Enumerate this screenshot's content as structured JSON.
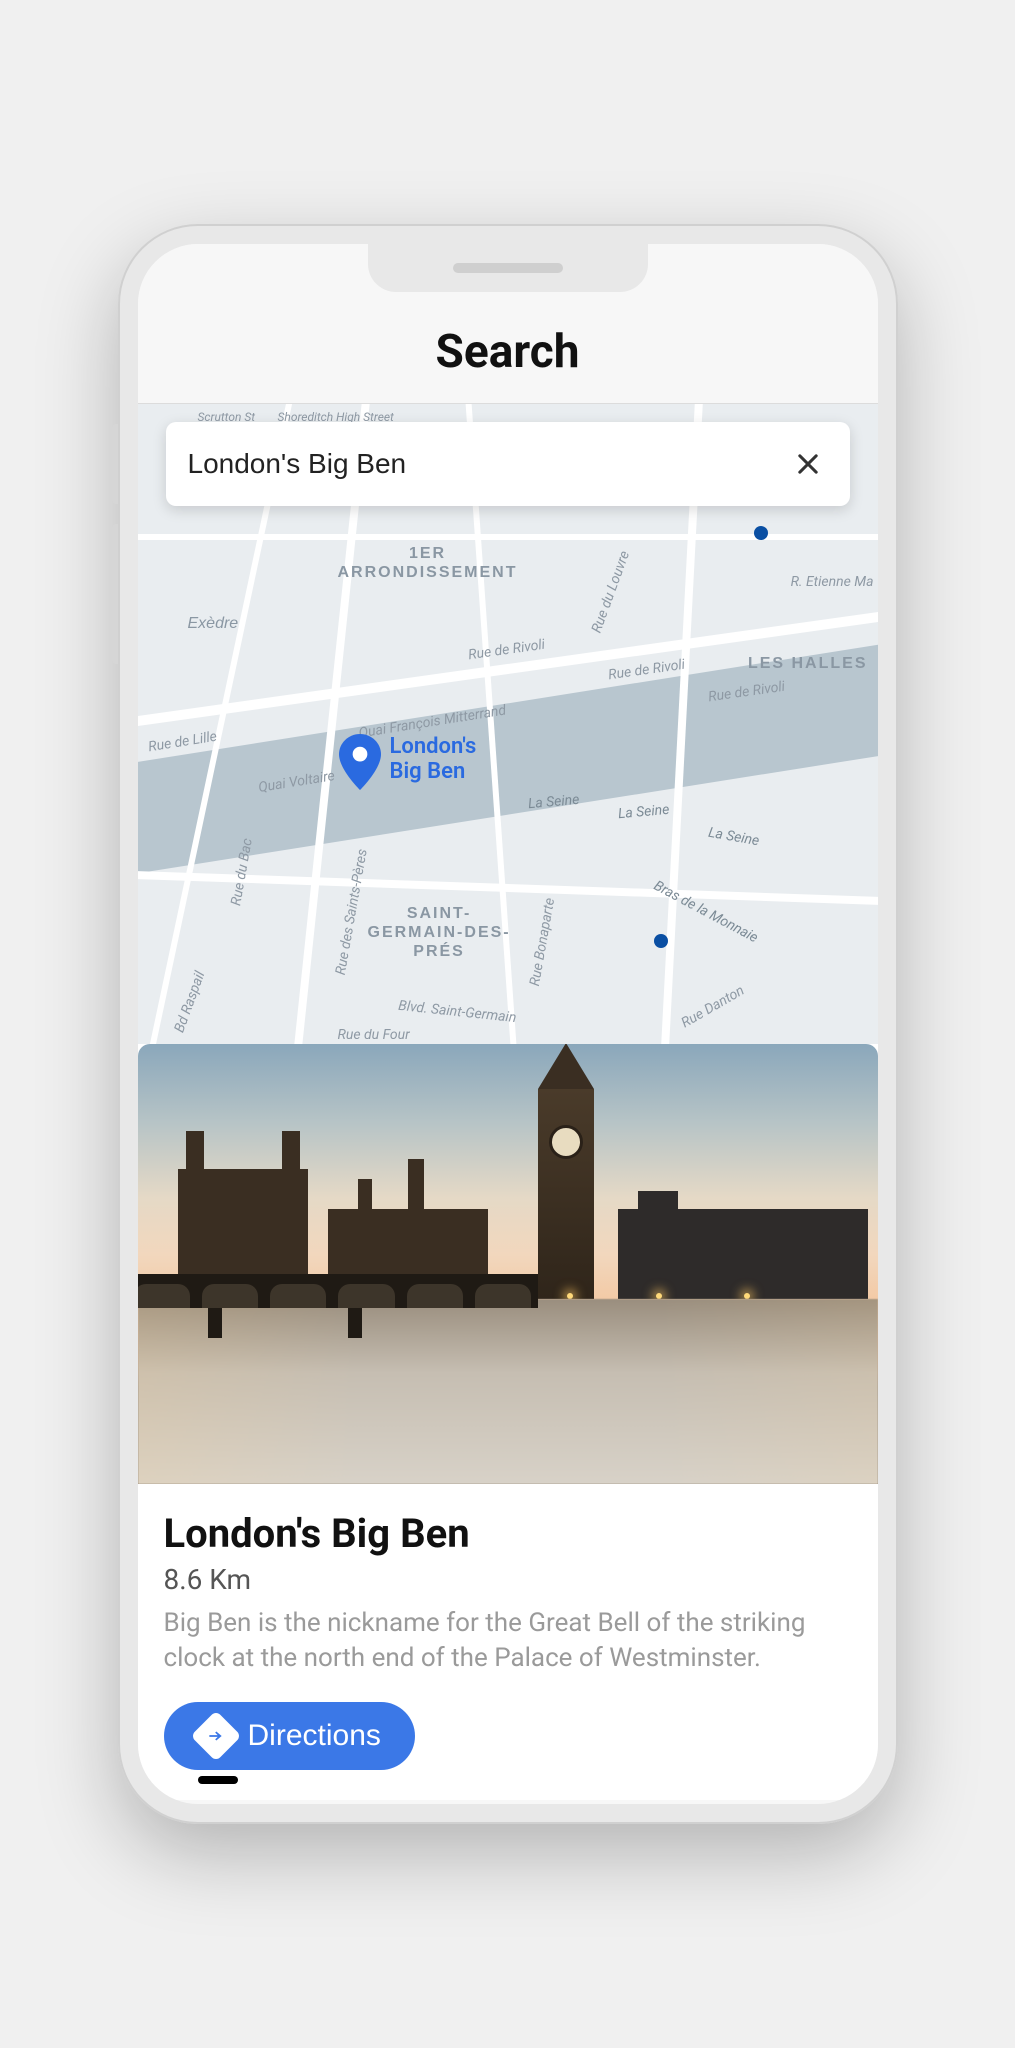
{
  "header": {
    "title": "Search"
  },
  "search": {
    "value": "London's Big Ben"
  },
  "map": {
    "pin_label_line1": "London's",
    "pin_label_line2": "Big Ben",
    "districts": {
      "arr1_line1": "1ER",
      "arr1_line2": "ARRONDISSEMENT",
      "leshalles": "LES HALLES",
      "exedre": "Exèdre",
      "stgermain_line1": "SAINT-",
      "stgermain_line2": "GERMAIN-DES-",
      "stgermain_line3": "PRÉS"
    },
    "streets": {
      "rivoli1": "Rue de Rivoli",
      "rivoli2": "Rue de Rivoli",
      "rivoli3": "Rue de Rivoli",
      "louvre": "Rue du Louvre",
      "etienne": "R. Etienne Ma",
      "quai_fr": "Quai François Mitterrand",
      "quai_vol": "Quai Voltaire",
      "seine1": "La Seine",
      "seine2": "La Seine",
      "seine3": "La Seine",
      "bras": "Bras de la Monnaie",
      "bac": "Rue du Bac",
      "sp": "Rue des Saints-Pères",
      "bona": "Rue Bonaparte",
      "danton": "Rue Danton",
      "raspail": "Bd Raspail",
      "bstg": "Blvd. Saint-Germain",
      "four": "Rue du Four",
      "lille": "Rue de Lille",
      "scrutton": "Scrutton St",
      "shoreditch": "Shoreditch High Street"
    }
  },
  "result": {
    "title": "London's Big Ben",
    "distance": "8.6 Km",
    "description": "Big Ben is the nickname for the Great Bell of the striking clock at the north end of the Palace of Westminster.",
    "directions_label": "Directions"
  }
}
